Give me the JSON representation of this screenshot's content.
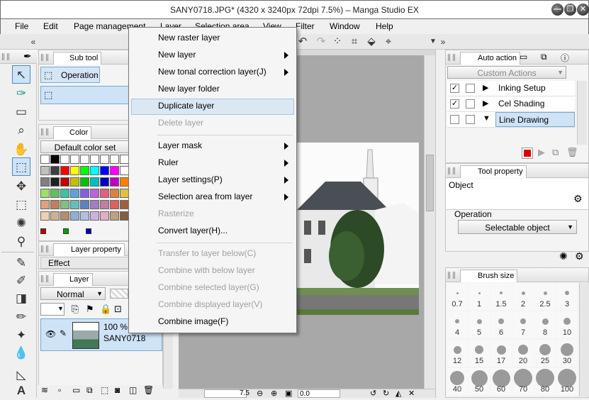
{
  "window": {
    "title": "SANY0718.JPG* (4320 x 3240px 72dpi 7.5%) – Manga Studio EX",
    "minimize_glyph": "—",
    "restore_glyph": "❐",
    "close_glyph": "✕"
  },
  "menubar": [
    "File",
    "Edit",
    "Page management",
    "Layer",
    "Selection area",
    "View",
    "Filter",
    "Window",
    "Help"
  ],
  "context_menu": {
    "items": [
      {
        "label": "New raster layer",
        "enabled": true,
        "submenu": false
      },
      {
        "label": "New layer",
        "enabled": true,
        "submenu": true
      },
      {
        "label": "New tonal correction layer(J)",
        "enabled": true,
        "submenu": true
      },
      {
        "label": "New layer folder",
        "enabled": true,
        "submenu": false
      },
      {
        "label": "Duplicate layer",
        "enabled": true,
        "submenu": false,
        "highlighted": true
      },
      {
        "label": "Delete layer",
        "enabled": false,
        "submenu": false
      },
      {
        "label": "Layer mask",
        "enabled": true,
        "submenu": true
      },
      {
        "label": "Ruler",
        "enabled": true,
        "submenu": true
      },
      {
        "label": "Layer settings(P)",
        "enabled": true,
        "submenu": true
      },
      {
        "label": "Selection area from layer",
        "enabled": true,
        "submenu": true
      },
      {
        "label": "Rasterize",
        "enabled": false,
        "submenu": false
      },
      {
        "label": "Convert layer(H)...",
        "enabled": true,
        "submenu": false
      },
      {
        "label": "Transfer to layer below(C)",
        "enabled": false,
        "submenu": false
      },
      {
        "label": "Combine with below layer",
        "enabled": false,
        "submenu": false
      },
      {
        "label": "Combine selected layer(G)",
        "enabled": false,
        "submenu": false
      },
      {
        "label": "Combine displayed layer(V)",
        "enabled": false,
        "submenu": false
      },
      {
        "label": "Combine image(F)",
        "enabled": true,
        "submenu": false
      }
    ]
  },
  "subtool_panel": {
    "tab": "Sub tool",
    "selected": "Operation"
  },
  "color_panel": {
    "tab": "Color",
    "set_name": "Default color set",
    "swatches": [
      "#ffffff",
      "#000000",
      "#ffffff",
      "#ffffff",
      "#ffffff",
      "#ffffff",
      "#ffffff",
      "#ffffff",
      "#ffffff",
      "#c0c0c0",
      "#404040",
      "#ff0000",
      "#ffff00",
      "#00ff00",
      "#00ffff",
      "#0000ff",
      "#ff00ff",
      "#ffffff",
      "#808080",
      "#202020",
      "#c00000",
      "#c0c000",
      "#00c000",
      "#00c0c0",
      "#0000c0",
      "#c000c0",
      "#ff8000",
      "#a0e060",
      "#60c060",
      "#40c0a0",
      "#60a0e0",
      "#8060e0",
      "#c060e0",
      "#e06080",
      "#e08040",
      "#e0c040",
      "#e0a080",
      "#c08060",
      "#80c080",
      "#60c0c0",
      "#6080c0",
      "#a080c0",
      "#c080a0",
      "#e06060",
      "#a06040",
      "#f0d0b0",
      "#d0b090",
      "#b09070",
      "#90b0d0",
      "#b0c0e0",
      "#d0b0e0",
      "#e0b0c0",
      "#c0a080",
      "#806040"
    ],
    "bottom_swatches": [
      "#c00000",
      "#00a000",
      "#0000c0"
    ]
  },
  "layer_property": {
    "tab": "Layer property",
    "effect_label": "Effect"
  },
  "layer_panel": {
    "tab": "Layer",
    "blend_mode": "Normal",
    "layers": [
      {
        "opacity": "100 %",
        "name": "SANY0718"
      }
    ]
  },
  "auto_action": {
    "tab": "Auto action",
    "set_name": "Custom Actions",
    "actions": [
      {
        "name": "Inking Setup",
        "checked": true,
        "expanded": false
      },
      {
        "name": "Cel Shading",
        "checked": true,
        "expanded": false
      },
      {
        "name": "Line Drawing",
        "checked": false,
        "expanded": true,
        "selected": true
      }
    ]
  },
  "tool_property": {
    "tab": "Tool property",
    "object_label": "Object",
    "operation_label": "Operation",
    "operation_value": "Selectable object"
  },
  "brush_size": {
    "tab": "Brush size",
    "sizes": [
      "0.7",
      "1",
      "1.5",
      "2",
      "2.5",
      "3",
      "4",
      "5",
      "6",
      "7",
      "8",
      "10",
      "12",
      "15",
      "17",
      "20",
      "25",
      "30",
      "40",
      "50",
      "60",
      "70",
      "80",
      "100"
    ]
  },
  "statusbar": {
    "zoom": "7.5",
    "angle": "0.0"
  }
}
